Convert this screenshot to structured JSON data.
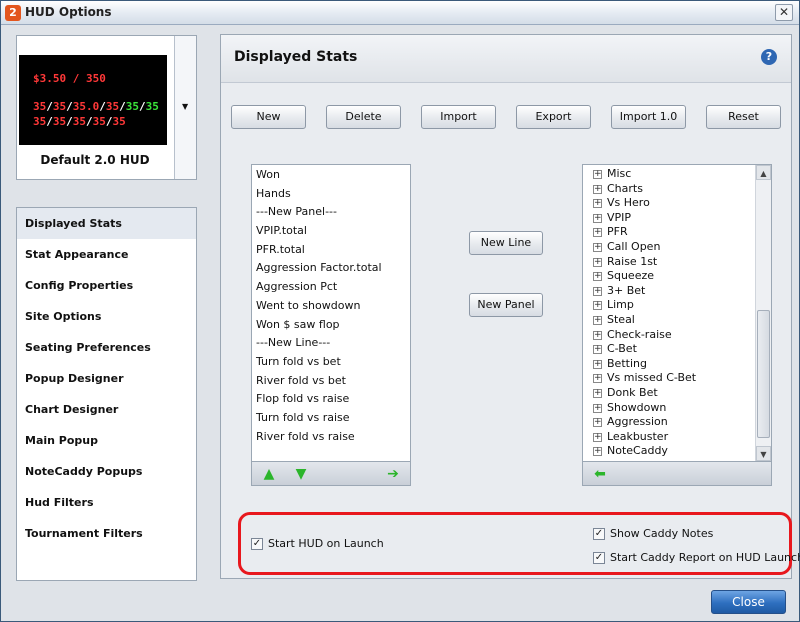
{
  "window": {
    "title": "HUD Options",
    "app_icon": "2",
    "close_glyph": "✕"
  },
  "hud": {
    "name": "Default 2.0 HUD",
    "preview": {
      "line1": "$3.50 / 350",
      "line2": [
        "35",
        "/",
        "35",
        "/",
        "35.0",
        "/",
        "35",
        "/",
        "35",
        "/",
        "35"
      ],
      "line3": [
        "35",
        "/",
        "35",
        "/",
        "35",
        "/",
        "35",
        "/",
        "35"
      ]
    },
    "dropdown_glyph": "▼"
  },
  "nav": {
    "items": [
      "Displayed Stats",
      "Stat Appearance",
      "Config Properties",
      "Site Options",
      "Seating Preferences",
      "Popup Designer",
      "Chart Designer",
      "Main Popup",
      "NoteCaddy Popups",
      "Hud Filters",
      "Tournament Filters"
    ],
    "selected": "Displayed Stats"
  },
  "main": {
    "title": "Displayed Stats",
    "help_glyph": "?",
    "toolbar": {
      "new": "New",
      "delete": "Delete",
      "import": "Import",
      "export": "Export",
      "import10": "Import 1.0",
      "reset": "Reset"
    },
    "center_buttons": {
      "new_line": "New Line",
      "new_panel": "New Panel"
    },
    "displayed_list": [
      "Won",
      "Hands",
      "---New Panel---",
      "VPIP.total",
      "PFR.total",
      "Aggression Factor.total",
      "Aggression Pct",
      "Went to showdown",
      "Won $ saw flop",
      "---New Line---",
      "Turn fold vs bet",
      "River fold vs bet",
      "Flop fold vs raise",
      "Turn fold vs raise",
      "River fold vs raise"
    ],
    "available_tree": [
      "Misc",
      "Charts",
      "Vs Hero",
      "VPIP",
      "PFR",
      "Call Open",
      "Raise 1st",
      "Squeeze",
      "3+ Bet",
      "Limp",
      "Steal",
      "Check-raise",
      "C-Bet",
      "Betting",
      "Vs missed C-Bet",
      "Donk Bet",
      "Showdown",
      "Aggression",
      "Leakbuster",
      "NoteCaddy"
    ],
    "tree_expander": "+",
    "options": {
      "start_hud": {
        "label": "Start HUD on Launch",
        "checked": true
      },
      "show_caddy": {
        "label": "Show Caddy Notes",
        "checked": true
      },
      "start_caddy": {
        "label": "Start Caddy Report on HUD Launch",
        "checked": true
      },
      "check_glyph": "✓"
    }
  },
  "footer": {
    "close_label": "Close"
  },
  "colors": {
    "highlight_border": "#e8171d",
    "primary_button": "#2e6fbf"
  },
  "icons": {
    "move_up": "arrow-up-icon",
    "move_down": "arrow-down-icon",
    "add_right": "arrow-right-icon",
    "remove_left": "arrow-left-icon"
  }
}
